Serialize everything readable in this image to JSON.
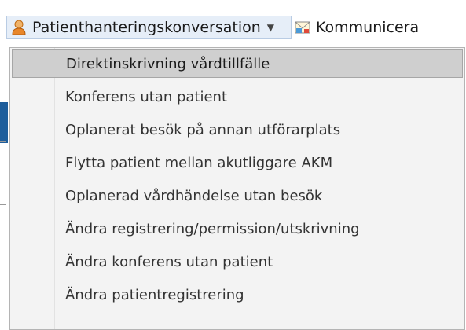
{
  "toolbar": {
    "active_menu": {
      "label": "Patienthanteringskonversation",
      "icon": "user-icon"
    },
    "next_menu": {
      "label": "Kommunicera",
      "icon": "message-icon"
    }
  },
  "menu": {
    "items": [
      {
        "label": "Direktinskrivning vårdtillfälle",
        "highlighted": true
      },
      {
        "label": "Konferens utan patient"
      },
      {
        "label": "Oplanerat besök på annan utförarplats"
      },
      {
        "label": "Flytta patient mellan akutliggare AKM"
      },
      {
        "label": "Oplanerad vårdhändelse utan besök"
      },
      {
        "label": "Ändra registrering/permission/utskrivning"
      },
      {
        "label": "Ändra konferens utan patient"
      },
      {
        "label": "Ändra patientregistrering"
      }
    ]
  },
  "colors": {
    "highlight": "#cfcfcf",
    "menu_bg": "#f3f3f3",
    "user_icon": "#e8862a",
    "edge_blue": "#1e5e9c"
  }
}
